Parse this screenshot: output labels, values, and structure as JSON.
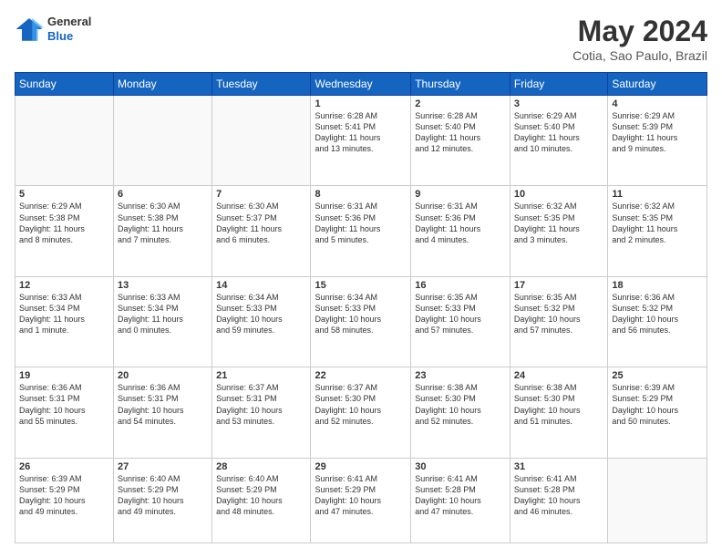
{
  "header": {
    "logo": {
      "general": "General",
      "blue": "Blue"
    },
    "title": "May 2024",
    "location": "Cotia, Sao Paulo, Brazil"
  },
  "weekdays": [
    "Sunday",
    "Monday",
    "Tuesday",
    "Wednesday",
    "Thursday",
    "Friday",
    "Saturday"
  ],
  "weeks": [
    [
      {
        "day": "",
        "content": ""
      },
      {
        "day": "",
        "content": ""
      },
      {
        "day": "",
        "content": ""
      },
      {
        "day": "1",
        "content": "Sunrise: 6:28 AM\nSunset: 5:41 PM\nDaylight: 11 hours\nand 13 minutes."
      },
      {
        "day": "2",
        "content": "Sunrise: 6:28 AM\nSunset: 5:40 PM\nDaylight: 11 hours\nand 12 minutes."
      },
      {
        "day": "3",
        "content": "Sunrise: 6:29 AM\nSunset: 5:40 PM\nDaylight: 11 hours\nand 10 minutes."
      },
      {
        "day": "4",
        "content": "Sunrise: 6:29 AM\nSunset: 5:39 PM\nDaylight: 11 hours\nand 9 minutes."
      }
    ],
    [
      {
        "day": "5",
        "content": "Sunrise: 6:29 AM\nSunset: 5:38 PM\nDaylight: 11 hours\nand 8 minutes."
      },
      {
        "day": "6",
        "content": "Sunrise: 6:30 AM\nSunset: 5:38 PM\nDaylight: 11 hours\nand 7 minutes."
      },
      {
        "day": "7",
        "content": "Sunrise: 6:30 AM\nSunset: 5:37 PM\nDaylight: 11 hours\nand 6 minutes."
      },
      {
        "day": "8",
        "content": "Sunrise: 6:31 AM\nSunset: 5:36 PM\nDaylight: 11 hours\nand 5 minutes."
      },
      {
        "day": "9",
        "content": "Sunrise: 6:31 AM\nSunset: 5:36 PM\nDaylight: 11 hours\nand 4 minutes."
      },
      {
        "day": "10",
        "content": "Sunrise: 6:32 AM\nSunset: 5:35 PM\nDaylight: 11 hours\nand 3 minutes."
      },
      {
        "day": "11",
        "content": "Sunrise: 6:32 AM\nSunset: 5:35 PM\nDaylight: 11 hours\nand 2 minutes."
      }
    ],
    [
      {
        "day": "12",
        "content": "Sunrise: 6:33 AM\nSunset: 5:34 PM\nDaylight: 11 hours\nand 1 minute."
      },
      {
        "day": "13",
        "content": "Sunrise: 6:33 AM\nSunset: 5:34 PM\nDaylight: 11 hours\nand 0 minutes."
      },
      {
        "day": "14",
        "content": "Sunrise: 6:34 AM\nSunset: 5:33 PM\nDaylight: 10 hours\nand 59 minutes."
      },
      {
        "day": "15",
        "content": "Sunrise: 6:34 AM\nSunset: 5:33 PM\nDaylight: 10 hours\nand 58 minutes."
      },
      {
        "day": "16",
        "content": "Sunrise: 6:35 AM\nSunset: 5:33 PM\nDaylight: 10 hours\nand 57 minutes."
      },
      {
        "day": "17",
        "content": "Sunrise: 6:35 AM\nSunset: 5:32 PM\nDaylight: 10 hours\nand 57 minutes."
      },
      {
        "day": "18",
        "content": "Sunrise: 6:36 AM\nSunset: 5:32 PM\nDaylight: 10 hours\nand 56 minutes."
      }
    ],
    [
      {
        "day": "19",
        "content": "Sunrise: 6:36 AM\nSunset: 5:31 PM\nDaylight: 10 hours\nand 55 minutes."
      },
      {
        "day": "20",
        "content": "Sunrise: 6:36 AM\nSunset: 5:31 PM\nDaylight: 10 hours\nand 54 minutes."
      },
      {
        "day": "21",
        "content": "Sunrise: 6:37 AM\nSunset: 5:31 PM\nDaylight: 10 hours\nand 53 minutes."
      },
      {
        "day": "22",
        "content": "Sunrise: 6:37 AM\nSunset: 5:30 PM\nDaylight: 10 hours\nand 52 minutes."
      },
      {
        "day": "23",
        "content": "Sunrise: 6:38 AM\nSunset: 5:30 PM\nDaylight: 10 hours\nand 52 minutes."
      },
      {
        "day": "24",
        "content": "Sunrise: 6:38 AM\nSunset: 5:30 PM\nDaylight: 10 hours\nand 51 minutes."
      },
      {
        "day": "25",
        "content": "Sunrise: 6:39 AM\nSunset: 5:29 PM\nDaylight: 10 hours\nand 50 minutes."
      }
    ],
    [
      {
        "day": "26",
        "content": "Sunrise: 6:39 AM\nSunset: 5:29 PM\nDaylight: 10 hours\nand 49 minutes."
      },
      {
        "day": "27",
        "content": "Sunrise: 6:40 AM\nSunset: 5:29 PM\nDaylight: 10 hours\nand 49 minutes."
      },
      {
        "day": "28",
        "content": "Sunrise: 6:40 AM\nSunset: 5:29 PM\nDaylight: 10 hours\nand 48 minutes."
      },
      {
        "day": "29",
        "content": "Sunrise: 6:41 AM\nSunset: 5:29 PM\nDaylight: 10 hours\nand 47 minutes."
      },
      {
        "day": "30",
        "content": "Sunrise: 6:41 AM\nSunset: 5:28 PM\nDaylight: 10 hours\nand 47 minutes."
      },
      {
        "day": "31",
        "content": "Sunrise: 6:41 AM\nSunset: 5:28 PM\nDaylight: 10 hours\nand 46 minutes."
      },
      {
        "day": "",
        "content": ""
      }
    ]
  ]
}
